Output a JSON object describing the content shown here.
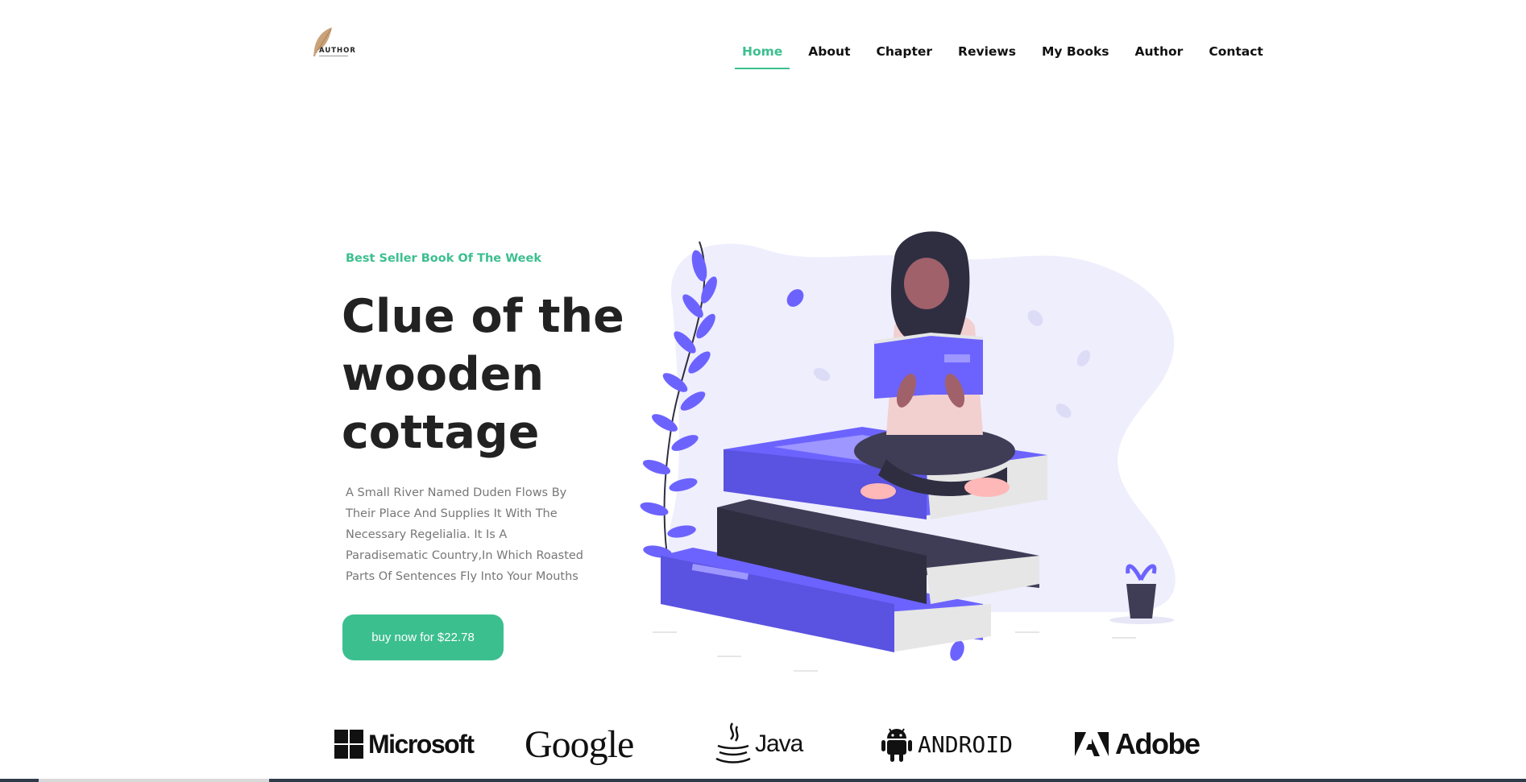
{
  "logo": {
    "text": "AUTHOR",
    "icon": "feather-quill-icon"
  },
  "nav": {
    "items": [
      {
        "label": "Home",
        "active": true
      },
      {
        "label": "About"
      },
      {
        "label": "Chapter"
      },
      {
        "label": "Reviews"
      },
      {
        "label": "My Books"
      },
      {
        "label": "Author"
      },
      {
        "label": "Contact"
      }
    ],
    "active_color": "#3cbf8f"
  },
  "hero": {
    "eyebrow": "Best Seller Book Of The Week",
    "title": "Clue of the wooden cottage",
    "description": "A Small River Named Duden Flows By Their Place And Supplies It With The Necessary Regelialia. It Is A Paradisematic Country,In Which Roasted Parts Of Sentences Fly Into Your Mouths",
    "cta_label": "buy now for $22.78",
    "illustration": "woman-reading-on-books-illustration",
    "accent": "#6c63ff"
  },
  "brands": [
    {
      "name": "Microsoft",
      "icon": "microsoft-windows-icon"
    },
    {
      "name": "Google"
    },
    {
      "name": "Java",
      "icon": "java-cup-icon"
    },
    {
      "name": "ANDROID",
      "icon": "android-robot-icon"
    },
    {
      "name": "Adobe",
      "icon": "adobe-a-icon"
    }
  ]
}
